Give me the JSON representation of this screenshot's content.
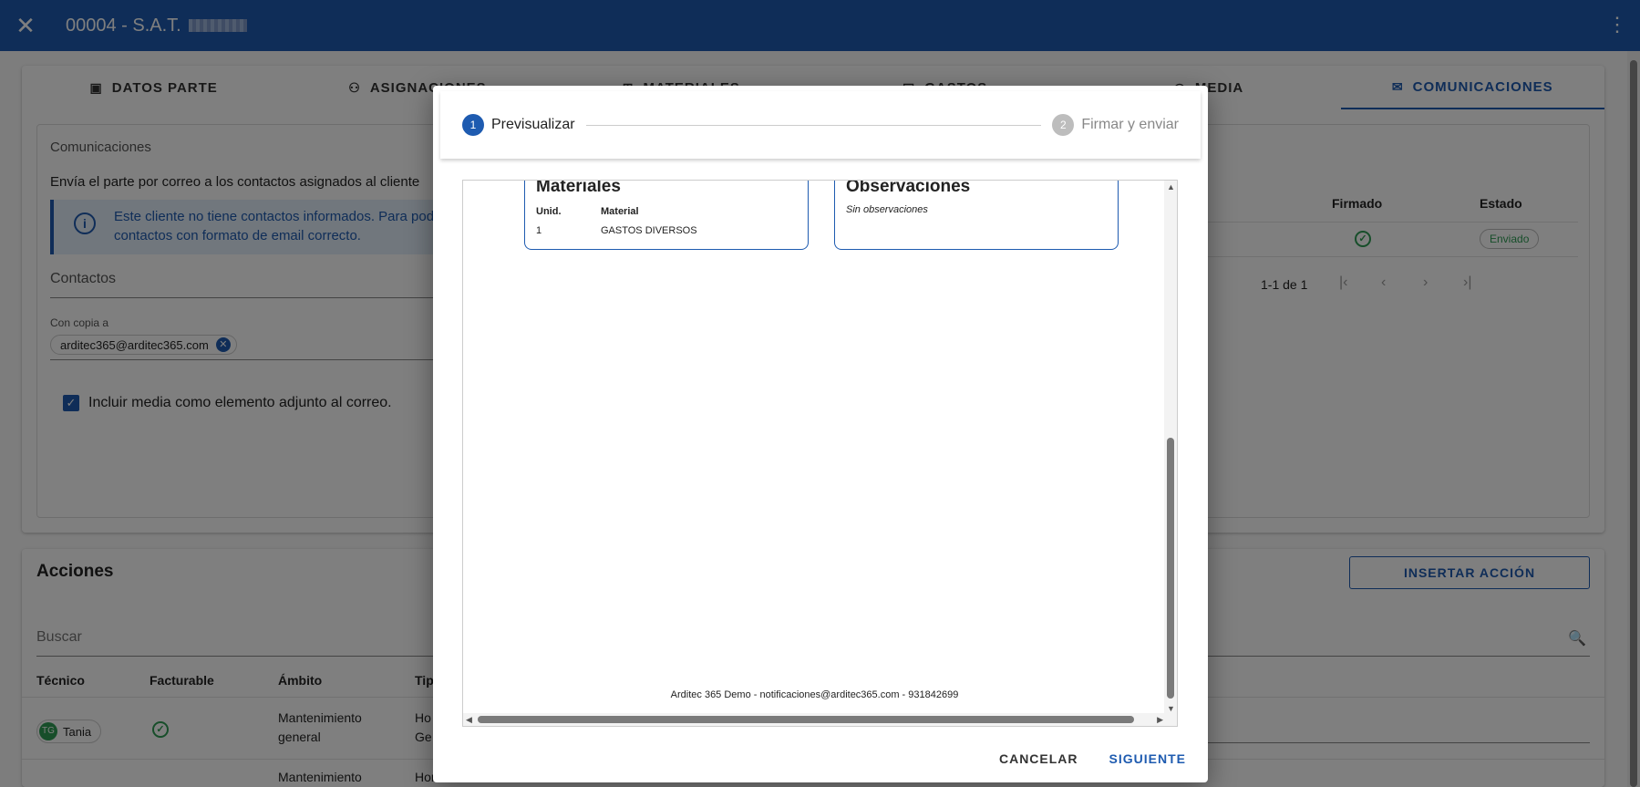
{
  "header": {
    "title": "00004 - S.A.T.",
    "close_icon": "close-icon",
    "menu_icon": "more-vert-icon"
  },
  "tabs": [
    {
      "label": "DATOS PARTE",
      "icon": "id-card-icon"
    },
    {
      "label": "ASIGNACIONES",
      "icon": "people-icon"
    },
    {
      "label": "MATERIALES",
      "icon": "cart-icon"
    },
    {
      "label": "GASTOS",
      "icon": "receipt-icon"
    },
    {
      "label": "MEDIA",
      "icon": "camera-icon"
    },
    {
      "label": "COMUNICACIONES",
      "icon": "mail-icon"
    }
  ],
  "comms": {
    "section_title": "Comunicaciones",
    "description": "Envía el parte por correo a los contactos asignados al cliente",
    "info_line1": "Este cliente no tiene contactos informados. Para pode",
    "info_line2": "contactos con formato de email correcto.",
    "contacts_label": "Contactos",
    "cc_label": "Con copia a",
    "cc_email": "arditec365@arditec365.com",
    "include_media_label": "Incluir media como elemento adjunto al correo."
  },
  "history": {
    "col_signed": "Firmado",
    "col_status": "Estado",
    "status_value": "Enviado",
    "pagination": "1-1 de 1"
  },
  "actions_card": {
    "title": "Acciones",
    "insert_button": "INSERTAR ACCIÓN",
    "search_placeholder": "Buscar",
    "columns": [
      "Técnico",
      "Facturable",
      "Ámbito",
      "Tip"
    ],
    "rows": [
      {
        "tech_initials": "TG",
        "tech_name": "Tania",
        "scope_line1": "Mantenimiento",
        "scope_line2": "general",
        "type_line1": "Ho",
        "type_line2": "Ge"
      },
      {
        "scope_line1": "Mantenimiento",
        "type_line1": "Horas"
      }
    ]
  },
  "dialog": {
    "step1_num": "1",
    "step1_label": "Previsualizar",
    "step2_num": "2",
    "step2_label": "Firmar y enviar",
    "doc": {
      "materials_title": "Materiales",
      "col_unit": "Unid.",
      "col_material": "Material",
      "row_unit": "1",
      "row_material": "GASTOS DIVERSOS",
      "obs_title": "Observaciones",
      "obs_text": "Sin observaciones",
      "footer": "Arditec 365 Demo - notificaciones@arditec365.com - 931842699"
    },
    "cancel_label": "CANCELAR",
    "next_label": "SIGUIENTE"
  },
  "colors": {
    "primary": "#1e5bb0",
    "success": "#2e9d55"
  }
}
